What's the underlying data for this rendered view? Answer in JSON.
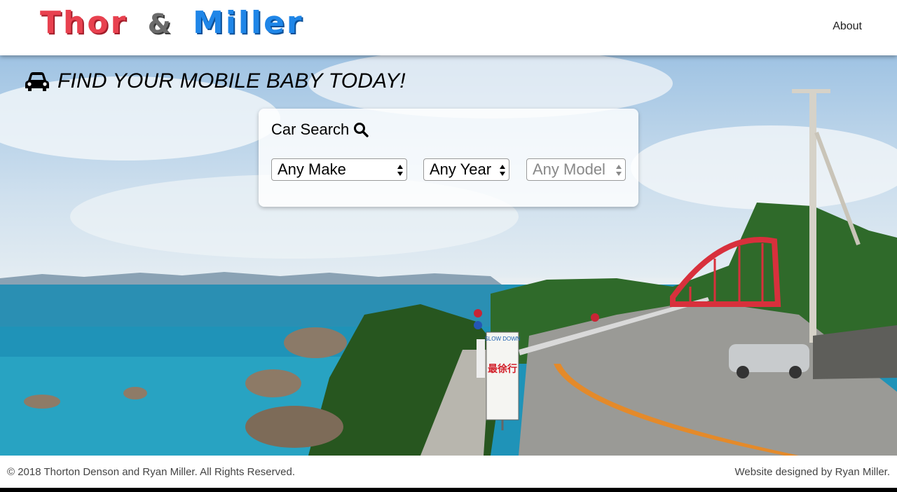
{
  "header": {
    "logo": {
      "word1": "Thor",
      "ampersand": "&",
      "word2": "Miller"
    },
    "nav": {
      "about": "About"
    }
  },
  "hero": {
    "tagline": "FIND YOUR MOBILE BABY TODAY!",
    "tagline_icon": "car-icon",
    "search": {
      "title": "Car Search",
      "title_icon": "search-icon",
      "make": {
        "selected": "Any Make"
      },
      "year": {
        "selected": "Any Year"
      },
      "model": {
        "selected": "Any Model",
        "disabled": true
      }
    },
    "signs": {
      "slow_down": "SLOW DOWN",
      "jp": "最徐行"
    }
  },
  "footer": {
    "copyright": "© 2018 Thorton Denson and Ryan Miller. All Rights Reserved.",
    "credit": "Website designed by Ryan Miller."
  },
  "colors": {
    "logo_red": "#e8414f",
    "logo_grey": "#6b6b6b",
    "logo_blue": "#1f86e8"
  }
}
